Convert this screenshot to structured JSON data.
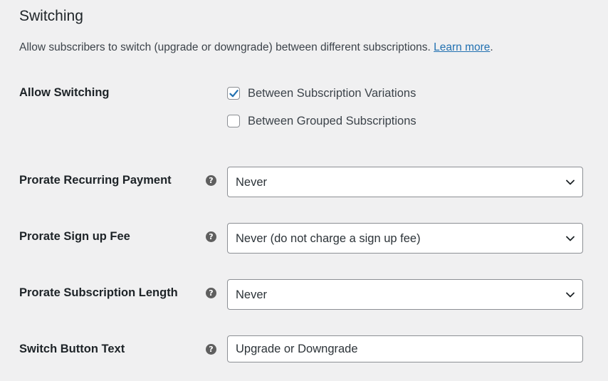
{
  "section": {
    "title": "Switching",
    "description": "Allow subscribers to switch (upgrade or downgrade) between different subscriptions.",
    "learn_more": "Learn more",
    "description_end": "."
  },
  "allow_switching": {
    "label": "Allow Switching",
    "options": [
      {
        "label": "Between Subscription Variations",
        "checked": true
      },
      {
        "label": "Between Grouped Subscriptions",
        "checked": false
      }
    ]
  },
  "prorate_recurring": {
    "label": "Prorate Recurring Payment",
    "value": "Never"
  },
  "prorate_signup": {
    "label": "Prorate Sign up Fee",
    "value": "Never (do not charge a sign up fee)"
  },
  "prorate_length": {
    "label": "Prorate Subscription Length",
    "value": "Never"
  },
  "switch_button_text": {
    "label": "Switch Button Text",
    "value": "Upgrade or Downgrade"
  },
  "icons": {
    "help": "question-mark-circle-icon",
    "checkbox_checked": "checkmark-icon",
    "select": "chevron-down-icon"
  },
  "help_glyph": "?",
  "colors": {
    "background": "#f0f0f1",
    "link": "#2271b1",
    "checkmark": "#2271b1",
    "help_icon_bg": "#5f5f5f",
    "border": "#8c8f94"
  }
}
